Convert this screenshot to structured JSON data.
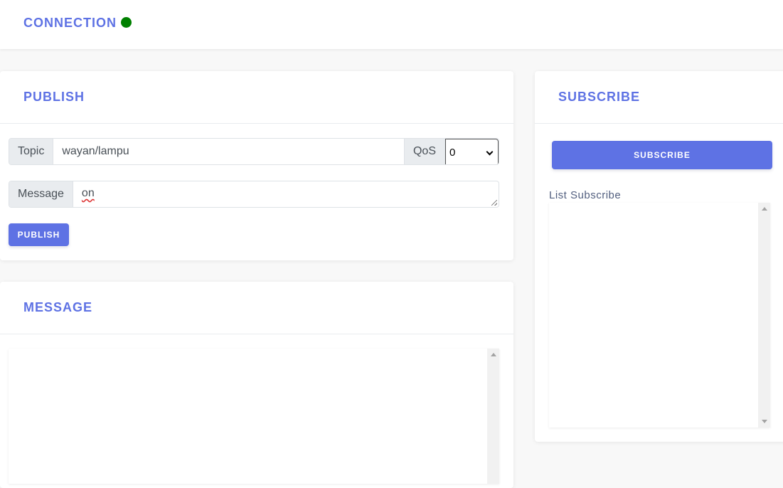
{
  "header": {
    "title": "CONNECTION",
    "status_color": "#008000"
  },
  "publish": {
    "title": "PUBLISH",
    "topic_label": "Topic",
    "topic_value": "wayan/lampu",
    "qos_label": "QoS",
    "qos_value": "0",
    "message_label": "Message",
    "message_value": "on",
    "button_label": "PUBLISH"
  },
  "message": {
    "title": "MESSAGE"
  },
  "subscribe": {
    "title": "SUBSCRIBE",
    "button_label": "SUBSCRIBE",
    "list_label": "List Subscribe"
  },
  "colors": {
    "accent": "#5e72e4",
    "background": "#f8f8f8",
    "addon_bg": "#e9ecef"
  },
  "icons": {
    "status": "status-dot-icon",
    "select_arrow": "chevron-down-icon",
    "scroll_up": "scroll-up-arrow-icon",
    "scroll_down": "scroll-down-arrow-icon"
  }
}
